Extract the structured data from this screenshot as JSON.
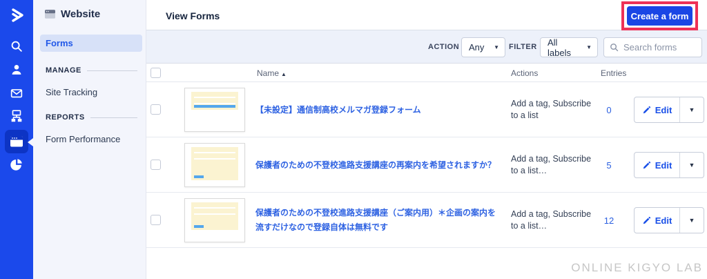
{
  "rail": {
    "icons": [
      {
        "name": "activecampaign-logo"
      },
      {
        "name": "search"
      },
      {
        "name": "contacts"
      },
      {
        "name": "campaigns"
      },
      {
        "name": "automations"
      },
      {
        "name": "website-forms",
        "active": true
      },
      {
        "name": "reports"
      }
    ]
  },
  "sidebar": {
    "title": "Website",
    "nav": [
      {
        "label": "Forms",
        "active": true
      }
    ],
    "sections": [
      {
        "header": "MANAGE",
        "items": [
          {
            "label": "Site Tracking"
          }
        ]
      },
      {
        "header": "REPORTS",
        "items": [
          {
            "label": "Form Performance"
          }
        ]
      }
    ]
  },
  "header": {
    "title": "View Forms",
    "create_button_label": "Create a form"
  },
  "filters": {
    "action_label": "ACTION",
    "action_value": "Any",
    "filter_label": "FILTER",
    "filter_value": "All labels",
    "search_placeholder": "Search forms"
  },
  "table": {
    "headers": {
      "name": "Name",
      "actions": "Actions",
      "entries": "Entries"
    },
    "rows": [
      {
        "name": "【未設定】通信制高校メルマガ登録フォーム",
        "actions": "Add a tag, Subscribe to a list",
        "entries": "0",
        "edit_label": "Edit"
      },
      {
        "name": "保護者のための不登校進路支援講座の再案内を希望されますか？",
        "actions": "Add a tag, Subscribe to a list…",
        "entries": "5",
        "edit_label": "Edit"
      },
      {
        "name": "保護者のための不登校進路支援講座（ご案内用）＊企画の案内を流すだけなので登録自体は無料です",
        "actions": "Add a tag, Subscribe to a list…",
        "entries": "12",
        "edit_label": "Edit"
      }
    ]
  },
  "watermark": "ONLINE KIGYO LAB",
  "colors": {
    "rail_blue": "#1b49eb",
    "active_tile_blue": "#0d34c4",
    "primary_button_blue": "#1a46e5",
    "link_blue": "#2e62e2",
    "highlight_red": "#ee3157",
    "sidebar_bg": "#f3f5fc",
    "filter_bar_bg": "#edf1fa",
    "selected_pill_bg": "#d7e1f8"
  }
}
